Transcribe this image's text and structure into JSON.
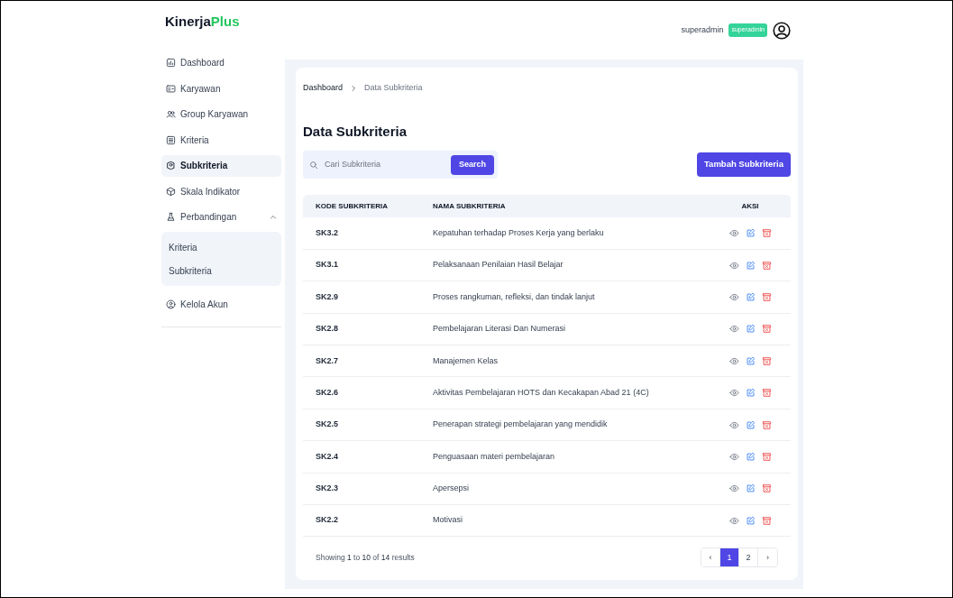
{
  "brand": {
    "name": "Kinerja",
    "accent": "Plus"
  },
  "header": {
    "user": "superadmin",
    "role_badge": "superadmin"
  },
  "sidebar": {
    "items": [
      {
        "label": "Dashboard",
        "selected": false
      },
      {
        "label": "Karyawan",
        "selected": false
      },
      {
        "label": "Group Karyawan",
        "selected": false
      },
      {
        "label": "Kriteria",
        "selected": false
      },
      {
        "label": "Subkriteria",
        "selected": true
      },
      {
        "label": "Skala Indikator",
        "selected": false
      },
      {
        "label": "Perbandingan",
        "selected": false,
        "expanded": true,
        "children": [
          {
            "label": "Kriteria",
            "selected": false
          },
          {
            "label": "Subkriteria",
            "selected": false
          }
        ]
      },
      {
        "label": "Kelola Akun",
        "selected": false
      }
    ]
  },
  "breadcrumb": [
    "Dashboard",
    "Data Subkriteria"
  ],
  "page_title": "Data Subkriteria",
  "search": {
    "placeholder": "Cari Subkriteria",
    "button": "Search"
  },
  "add_button": "Tambah Subkriteria",
  "table": {
    "columns": [
      "KODE SUBKRITERIA",
      "NAMA SUBKRITERIA",
      "AKSI"
    ],
    "rows": [
      {
        "code": "SK3.2",
        "name": "Kepatuhan terhadap Proses Kerja yang berlaku"
      },
      {
        "code": "SK3.1",
        "name": "Pelaksanaan Penilaian Hasil Belajar"
      },
      {
        "code": "SK2.9",
        "name": "Proses rangkuman, refleksi, dan tindak lanjut"
      },
      {
        "code": "SK2.8",
        "name": "Pembelajaran Literasi Dan Numerasi"
      },
      {
        "code": "SK2.7",
        "name": "Manajemen Kelas"
      },
      {
        "code": "SK2.6",
        "name": "Aktivitas Pembelajaran HOTS dan Kecakapan Abad 21 (4C)"
      },
      {
        "code": "SK2.5",
        "name": "Penerapan strategi pembelajaran yang mendidik"
      },
      {
        "code": "SK2.4",
        "name": "Penguasaan materi pembelajaran"
      },
      {
        "code": "SK2.3",
        "name": "Apersepsi"
      },
      {
        "code": "SK2.2",
        "name": "Motivasi"
      }
    ]
  },
  "pagination": {
    "summary": "Showing **1** to **10** of **14** results",
    "prev": "‹",
    "next": "›",
    "pages": [
      {
        "label": "1",
        "selected": true
      },
      {
        "label": "2",
        "selected": false
      }
    ]
  }
}
